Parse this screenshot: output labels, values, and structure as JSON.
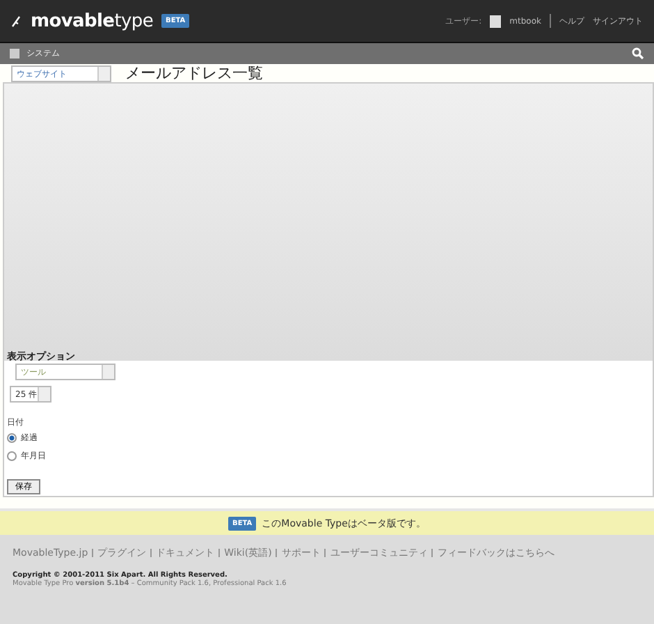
{
  "header": {
    "logo": "**movable**type",
    "beta": "BETA",
    "user_label": "ユーザー:",
    "user": "mtbook",
    "links": [
      "ヘルプ",
      "サインアウト"
    ]
  },
  "nav": {
    "scope": "システム"
  },
  "website_select": "ウェブサイト",
  "page_title": "メールアドレス一覧",
  "display_options": {
    "title": "表示オプション",
    "tool_select": "ツール",
    "per_page": "25 件",
    "date_label": "日付",
    "date_options": [
      {
        "label": "経過",
        "selected": true
      },
      {
        "label": "年月日",
        "selected": false
      }
    ],
    "save": "保存"
  },
  "beta_notice": {
    "badge": "BETA",
    "text": "このMovable Typeはベータ版です。"
  },
  "footer": {
    "links": [
      "MovableType.jp",
      "プラグイン",
      "ドキュメント",
      "Wiki(英語)",
      "サポート",
      "ユーザーコミュニティ",
      "フィードバックはこちらへ"
    ],
    "copyright": "Copyright © 2001-2011 Six Apart. All Rights Reserved.",
    "version": "Movable Type Pro **version 5.1b4** – Community Pack 1.6, Professional Pack 1.6"
  }
}
